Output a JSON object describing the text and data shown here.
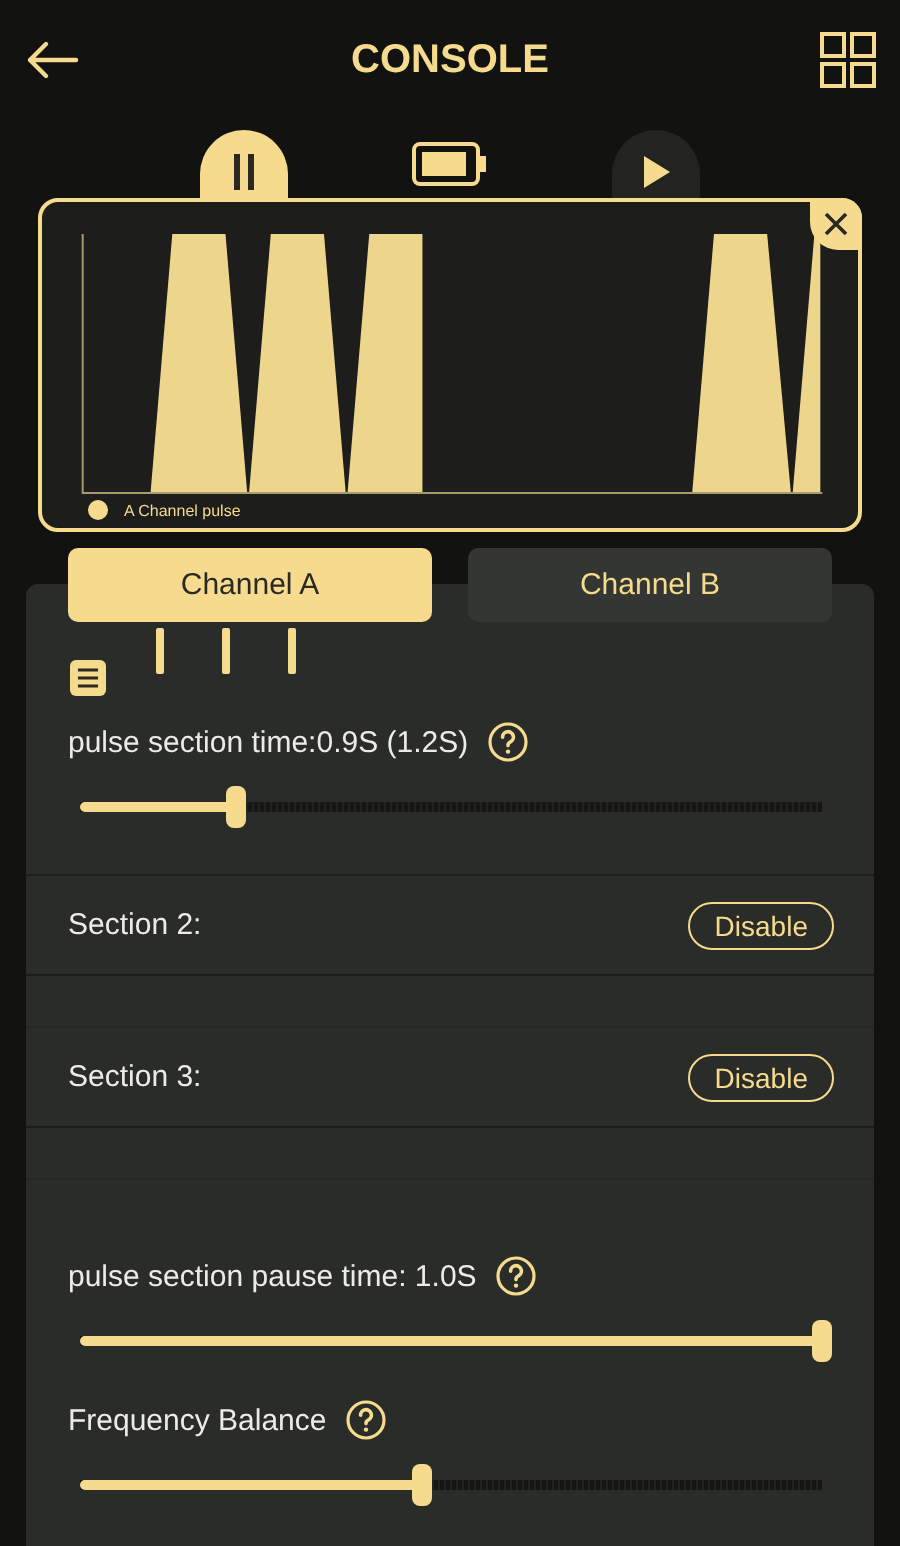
{
  "header": {
    "title": "CONSOLE"
  },
  "transport": [
    {
      "kind": "pause",
      "selected": true
    },
    {
      "kind": "play",
      "selected": false
    }
  ],
  "chart": {
    "legend": "A Channel pulse"
  },
  "tabs": [
    {
      "label": "Channel A",
      "selected": true
    },
    {
      "label": "Channel B",
      "selected": false
    }
  ],
  "settings": [
    {
      "kind": "slider",
      "label": "pulse section time:0.9S (1.2S)",
      "help": true,
      "level": 0.21
    },
    {
      "kind": "section",
      "label": "Section 2:",
      "button": "Disable"
    },
    {
      "kind": "section",
      "label": "Section 3:",
      "button": "Disable"
    },
    {
      "kind": "slider",
      "label": "pulse section pause time: 1.0S",
      "help": true,
      "level": 1.0
    },
    {
      "kind": "slider",
      "label": "Frequency Balance",
      "help": true,
      "level": 0.46
    }
  ]
}
